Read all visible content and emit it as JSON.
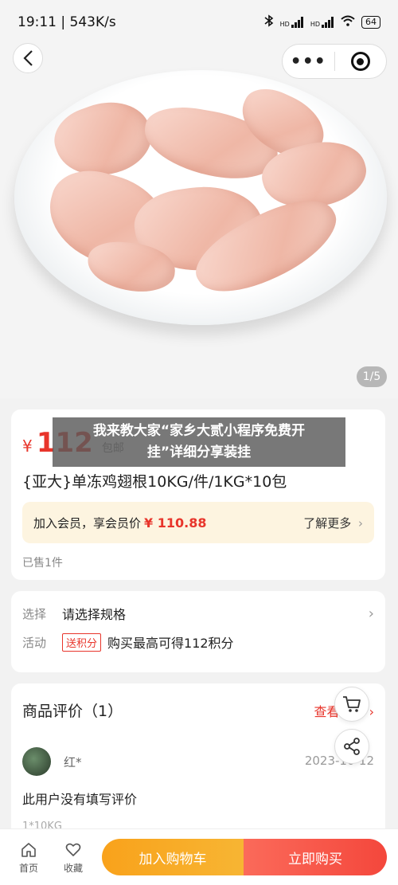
{
  "status_bar": {
    "time_speed": "19:11 | 543K/s",
    "signal_label_1": "HD",
    "signal_label_2": "HD",
    "battery": "64"
  },
  "header": {
    "more_label": "•••"
  },
  "gallery": {
    "counter": "1/5"
  },
  "price_card": {
    "currency": "¥",
    "price": "112",
    "shipping_tag": "包邮",
    "title": "{亚大}单冻鸡翅根10KG/件/1KG*10包",
    "member_text": "加入会员，享会员价",
    "member_price": "¥ 110.88",
    "member_more": "了解更多",
    "sold": "已售1件"
  },
  "spec_card": {
    "select_label": "选择",
    "select_value": "请选择规格",
    "activity_label": "活动",
    "activity_badge": "送积分",
    "activity_value": "购买最高可得112积分"
  },
  "review_card": {
    "title": "商品评价（1）",
    "view_all": "查看全部",
    "reviewer": "红*",
    "date": "2023-10-12",
    "text": "此用户没有填写评价",
    "spec": "1*10KG"
  },
  "bottom_bar": {
    "home_label": "首页",
    "fav_label": "收藏",
    "add_cart_label": "加入购物车",
    "buy_now_label": "立即购买"
  },
  "overlay": {
    "line1": "我来教大家“家乡大贰小程序免费开",
    "line2": "挂”详细分享装挂"
  }
}
